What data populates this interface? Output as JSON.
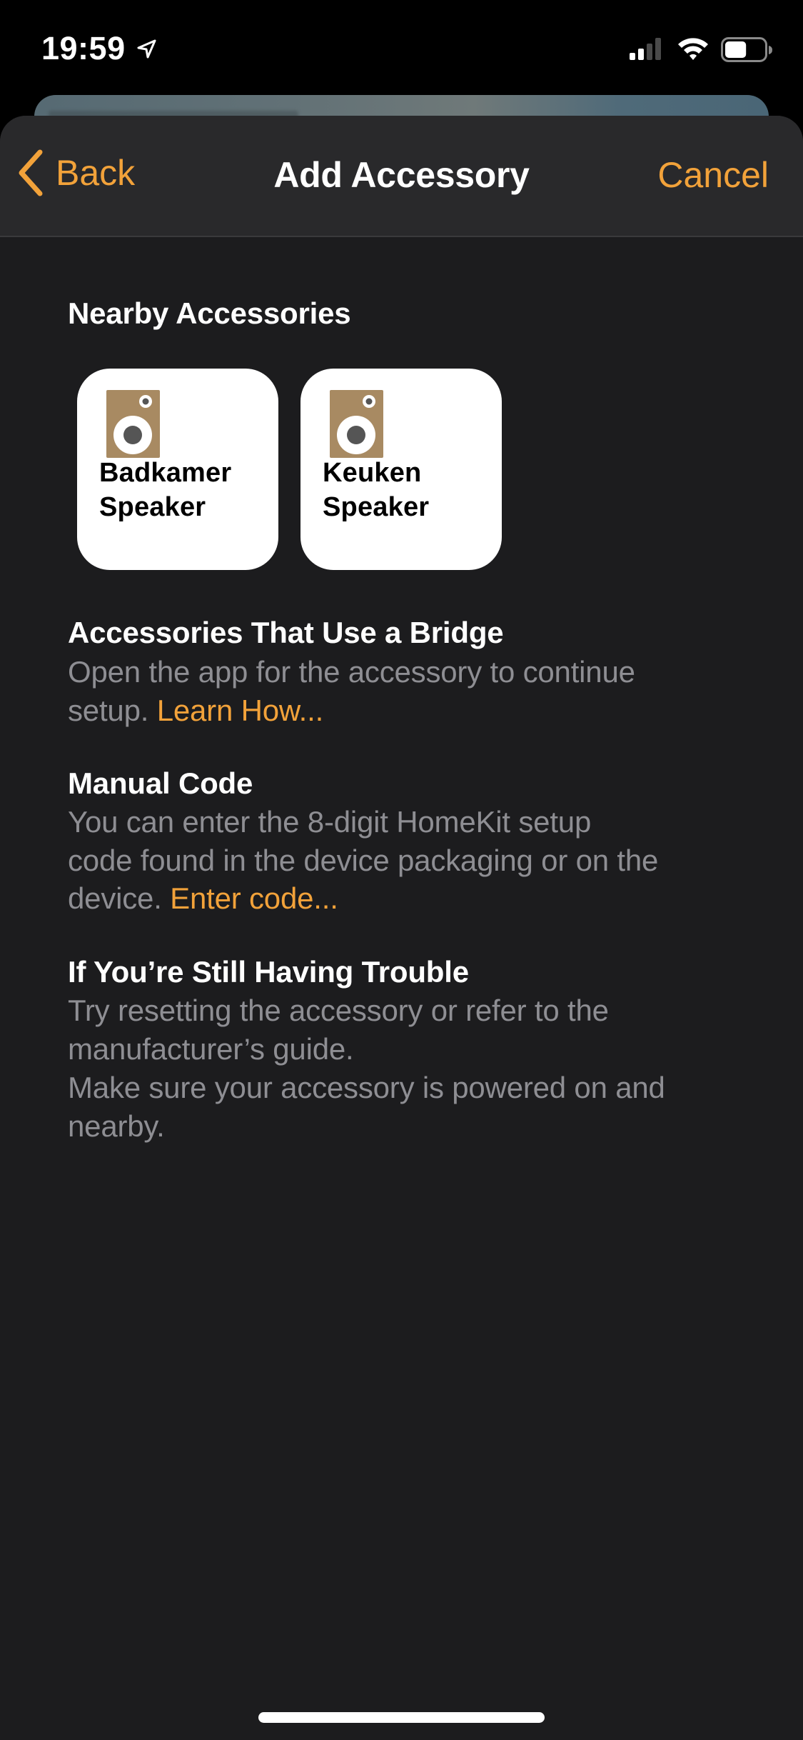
{
  "status_bar": {
    "time": "19:59",
    "location_icon": "location-arrow-icon",
    "signal_bars_active": 2,
    "signal_bars_total": 4,
    "wifi_icon": "wifi-icon",
    "battery_level_fraction": 0.55
  },
  "nav": {
    "back_label": "Back",
    "title": "Add Accessory",
    "cancel_label": "Cancel"
  },
  "colors": {
    "accent": "#F2A23A",
    "sheet_background": "#1C1C1E",
    "navbar_background": "#29292B",
    "secondary_text": "#8E8E93",
    "speaker_icon": "#A88A62"
  },
  "nearby": {
    "heading": "Nearby Accessories",
    "accessories": [
      {
        "name_lines": [
          "Badkamer",
          "Speaker"
        ],
        "icon": "speaker-icon"
      },
      {
        "name_lines": [
          "Keuken",
          "Speaker"
        ],
        "icon": "speaker-icon"
      }
    ]
  },
  "bridge": {
    "heading": "Accessories That Use a Bridge",
    "line1": "Open the app for the accessory to continue",
    "line2_text": "setup. ",
    "link": "Learn How..."
  },
  "manual_code": {
    "heading": "Manual Code",
    "line1": "You can enter the 8-digit HomeKit setup",
    "line2": "code found in the device packaging or on the",
    "line3_text": "device. ",
    "link": "Enter code..."
  },
  "trouble": {
    "heading": "If You’re Still Having Trouble",
    "lines": [
      "Try resetting the accessory or refer to the",
      "manufacturer’s guide.",
      "Make sure your accessory is powered on and",
      "nearby."
    ]
  }
}
